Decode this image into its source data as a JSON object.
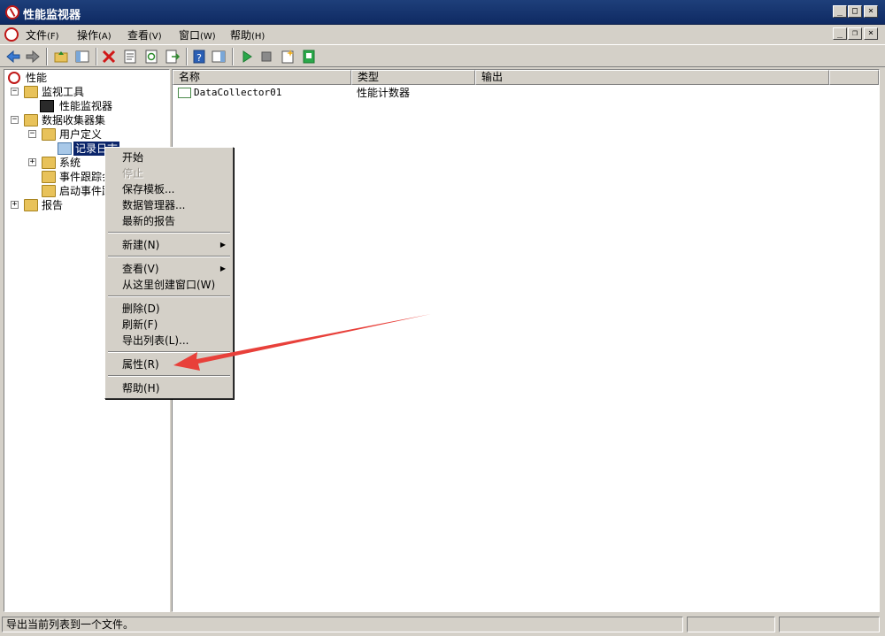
{
  "window": {
    "title": "性能监视器"
  },
  "menubar": {
    "items": [
      {
        "label": "文件",
        "accel": "(F)"
      },
      {
        "label": "操作",
        "accel": "(A)"
      },
      {
        "label": "查看",
        "accel": "(V)"
      },
      {
        "label": "窗口",
        "accel": "(W)"
      },
      {
        "label": "帮助",
        "accel": "(H)"
      }
    ]
  },
  "tree": {
    "root": "性能",
    "monitor_tools": "监视工具",
    "perf_monitor": "性能监视器",
    "data_collector_sets": "数据收集器集",
    "user_defined": "用户定义",
    "record_log": "记录日志",
    "system": "系统",
    "event_trace": "事件跟踪会话",
    "startup_event": "启动事件跟踪会话",
    "reports": "报告"
  },
  "list": {
    "columns": [
      "名称",
      "类型",
      "输出"
    ],
    "rows": [
      {
        "name": "DataCollector01",
        "type": "性能计数器",
        "output": ""
      }
    ]
  },
  "context_menu": {
    "start": "开始",
    "stop": "停止",
    "save_template": "保存模板...",
    "data_manager": "数据管理器...",
    "latest_report": "最新的报告",
    "new": "新建(N)",
    "view": "查看(V)",
    "new_window": "从这里创建窗口(W)",
    "delete": "删除(D)",
    "refresh": "刷新(F)",
    "export_list": "导出列表(L)...",
    "properties": "属性(R)",
    "help": "帮助(H)"
  },
  "statusbar": {
    "text": "导出当前列表到一个文件。"
  },
  "colors": {
    "titlebar": "#0f2a63",
    "selection": "#0a246a",
    "annotation_arrow": "#e8403a"
  }
}
